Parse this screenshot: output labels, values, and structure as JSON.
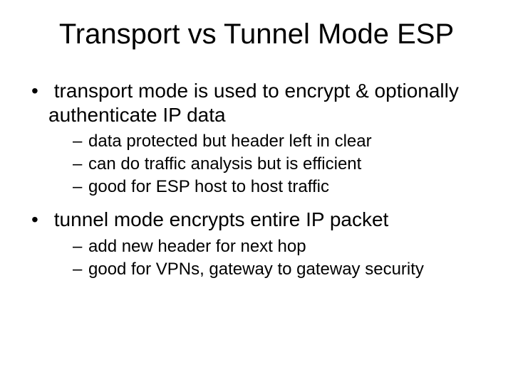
{
  "title": "Transport vs Tunnel Mode ESP",
  "bullets": [
    {
      "text": "transport mode is used to encrypt & optionally authenticate IP data",
      "sub": [
        "data protected but header left in clear",
        "can do traffic analysis but is efficient",
        "good for ESP host to host traffic"
      ]
    },
    {
      "text": "tunnel mode encrypts entire IP packet",
      "sub": [
        "add new header for next hop",
        "good for VPNs, gateway to gateway security"
      ]
    }
  ]
}
